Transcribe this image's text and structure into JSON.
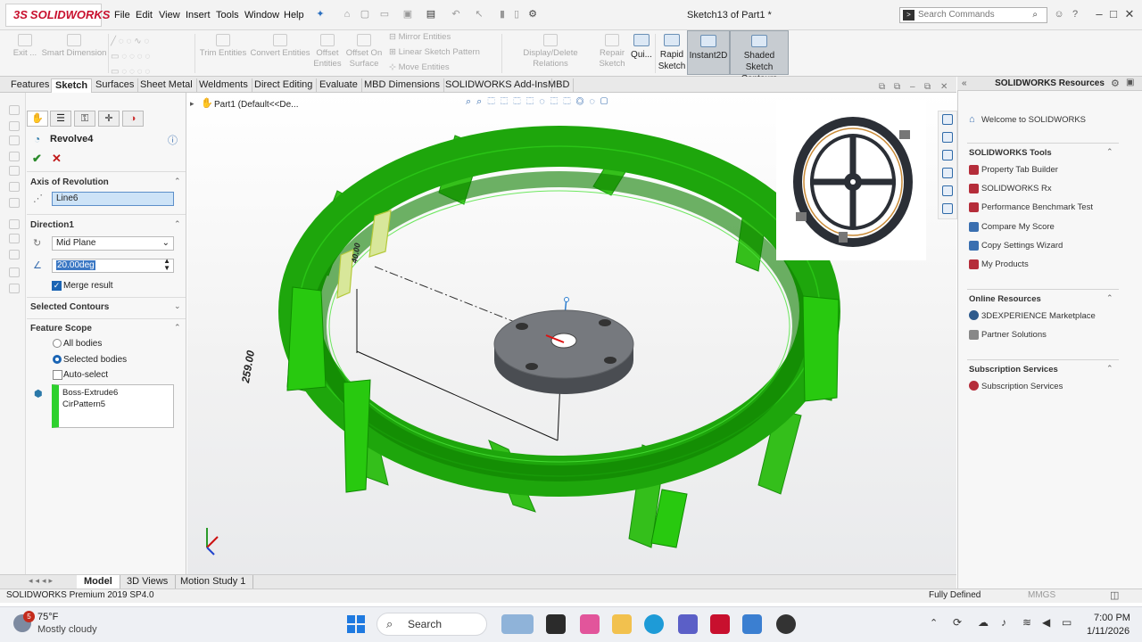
{
  "app": {
    "brand": "SOLIDWORKS",
    "brand_prefix": "3S",
    "document_title": "Sketch13 of Part1 *",
    "menu": [
      "File",
      "Edit",
      "View",
      "Insert",
      "Tools",
      "Window",
      "Help"
    ],
    "search_placeholder": "Search Commands"
  },
  "ribbon": {
    "exit": "Exit ...",
    "smart_dimension": "Smart Dimension",
    "trim_entities": "Trim Entities",
    "convert_entities": "Convert Entities",
    "offset_entities": "Offset Entities",
    "offset_on_surface": "Offset On Surface",
    "mirror_entities": "Mirror Entities",
    "linear_sketch_pattern": "Linear Sketch Pattern",
    "move_entities": "Move Entities",
    "display_delete_relations": "Display/Delete Relations",
    "repair_sketch": "Repair Sketch",
    "quick_snaps": "Qui...",
    "rapid_sketch": "Rapid Sketch",
    "instant2d": "Instant2D",
    "shaded_sketch_contours": "Shaded Sketch Contours"
  },
  "tabs": [
    "Features",
    "Sketch",
    "Surfaces",
    "Sheet Metal",
    "Weldments",
    "Direct Editing",
    "Evaluate",
    "MBD Dimensions",
    "SOLIDWORKS Add-Ins",
    "MBD"
  ],
  "active_tab": "Sketch",
  "property_manager": {
    "title": "Revolve4",
    "axis_section": "Axis of Revolution",
    "axis_value": "Line6",
    "direction_section": "Direction1",
    "direction_type": "Mid Plane",
    "angle": "20.00deg",
    "merge_result": "Merge result",
    "merge_checked": true,
    "selected_contours": "Selected Contours",
    "feature_scope": "Feature Scope",
    "all_bodies": "All bodies",
    "selected_bodies": "Selected bodies",
    "auto_select": "Auto-select",
    "bodies": [
      "Boss-Extrude6",
      "CirPattern5"
    ]
  },
  "viewport": {
    "tree_item": "Part1  (Default<<De...",
    "dimension_1": "259.00",
    "dimension_2": "40.00",
    "model_color": "#22c400"
  },
  "bottom_tabs": [
    "Model",
    "3D Views",
    "Motion Study 1"
  ],
  "status": {
    "version": "SOLIDWORKS Premium 2019 SP4.0",
    "state": "Fully Defined",
    "units": "MMGS"
  },
  "resources": {
    "title": "SOLIDWORKS Resources",
    "welcome": "Welcome to SOLIDWORKS",
    "tools_section": "SOLIDWORKS Tools",
    "tools": [
      "Property Tab Builder",
      "SOLIDWORKS Rx",
      "Performance Benchmark Test",
      "Compare My Score",
      "Copy Settings Wizard",
      "My Products"
    ],
    "online_section": "Online Resources",
    "online": [
      "3DEXPERIENCE Marketplace",
      "Partner Solutions"
    ],
    "subscription_section": "Subscription Services",
    "subscription": [
      "Subscription Services"
    ]
  },
  "taskbar": {
    "weather_temp": "75°F",
    "weather_desc": "Mostly cloudy",
    "weather_badge": "5",
    "search": "Search",
    "time": "7:00 PM",
    "date": "1/11/2026"
  }
}
